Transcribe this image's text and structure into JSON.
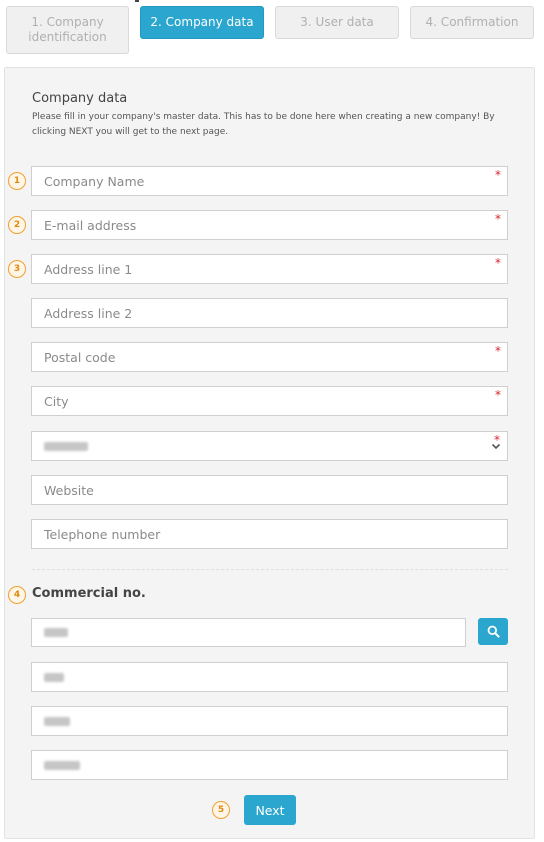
{
  "wizard": {
    "steps": [
      {
        "label": "1. Company identification"
      },
      {
        "label": "2. Company data"
      },
      {
        "label": "3. User data"
      },
      {
        "label": "4. Confirmation"
      }
    ]
  },
  "company_data": {
    "title": "Company data",
    "intro": "Please fill in your company's master data. This has to be done here when creating a new company! By clicking NEXT you will get to the next page.",
    "required_marker": "*",
    "fields": {
      "company_name": {
        "placeholder": "Company Name",
        "required": true
      },
      "email": {
        "placeholder": "E-mail address",
        "required": true
      },
      "address1": {
        "placeholder": "Address line 1",
        "required": true
      },
      "address2": {
        "placeholder": "Address line 2",
        "required": false
      },
      "postal_code": {
        "placeholder": "Postal code",
        "required": true
      },
      "city": {
        "placeholder": "City",
        "required": true
      },
      "country": {
        "required": true
      },
      "website": {
        "placeholder": "Website",
        "required": false
      },
      "telephone": {
        "placeholder": "Telephone number",
        "required": false
      }
    }
  },
  "commercial": {
    "title": "Commercial no."
  },
  "badges": [
    "1",
    "2",
    "3",
    "4",
    "5"
  ],
  "buttons": {
    "next": "Next"
  },
  "colors": {
    "accent": "#2aa6cf",
    "required": "#d9262c",
    "badge": "#f0a030"
  },
  "icons": {
    "search": "search-icon",
    "dropdown": "chevron-down-icon"
  }
}
